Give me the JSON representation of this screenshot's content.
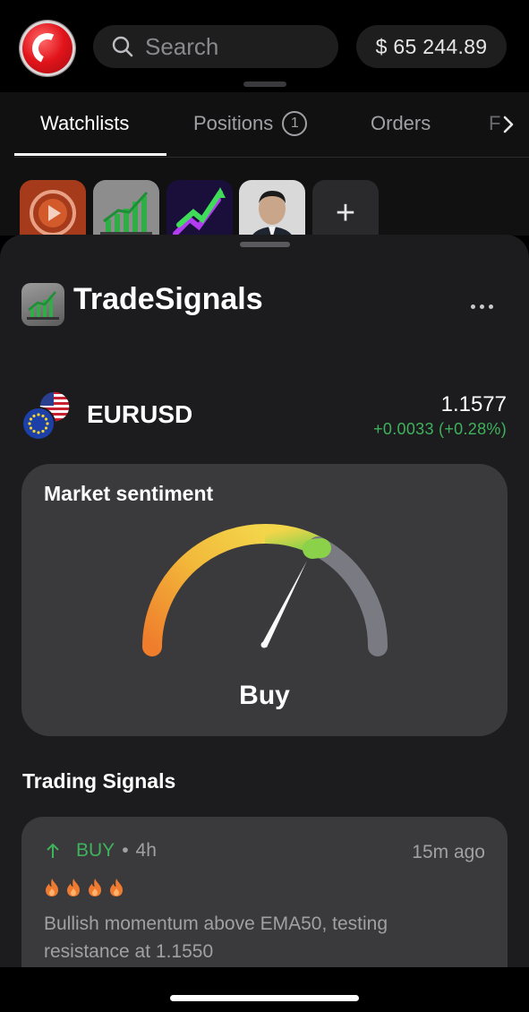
{
  "header": {
    "search_placeholder": "Search",
    "balance": "$ 65 244.89"
  },
  "tabs": [
    {
      "label": "Watchlists",
      "active": true
    },
    {
      "label": "Positions",
      "badge": "1"
    },
    {
      "label": "Orders"
    },
    {
      "label": "F"
    }
  ],
  "tiles": {
    "add_label": "+"
  },
  "app": {
    "title": "TradeSignals"
  },
  "instrument": {
    "symbol": "EURUSD",
    "price": "1.1577",
    "change": "+0.0033 (+0.28%)",
    "change_color": "#3fb25c"
  },
  "sentiment": {
    "title": "Market sentiment",
    "verdict": "Buy"
  },
  "signals": {
    "section_title": "Trading Signals",
    "items": [
      {
        "type": "BUY",
        "timeframe": "4h",
        "time_ago": "15m ago",
        "strength": 4,
        "description": "Bullish momentum above EMA50, testing resistance at 1.1550"
      }
    ]
  },
  "colors": {
    "accent_green": "#3fb25c",
    "flame": "#f07a2f"
  }
}
